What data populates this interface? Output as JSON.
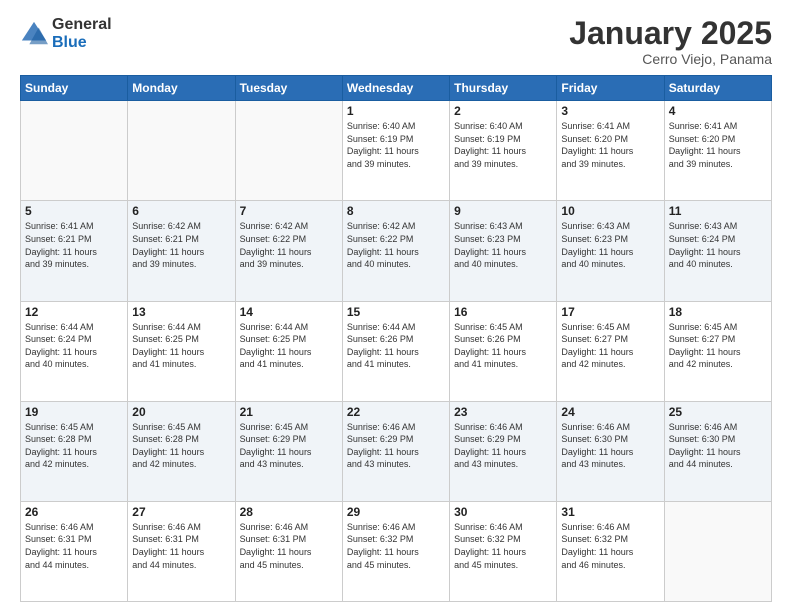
{
  "header": {
    "logo_general": "General",
    "logo_blue": "Blue",
    "month_title": "January 2025",
    "location": "Cerro Viejo, Panama"
  },
  "days_of_week": [
    "Sunday",
    "Monday",
    "Tuesday",
    "Wednesday",
    "Thursday",
    "Friday",
    "Saturday"
  ],
  "weeks": [
    {
      "alt": false,
      "days": [
        {
          "num": "",
          "info": ""
        },
        {
          "num": "",
          "info": ""
        },
        {
          "num": "",
          "info": ""
        },
        {
          "num": "1",
          "info": "Sunrise: 6:40 AM\nSunset: 6:19 PM\nDaylight: 11 hours\nand 39 minutes."
        },
        {
          "num": "2",
          "info": "Sunrise: 6:40 AM\nSunset: 6:19 PM\nDaylight: 11 hours\nand 39 minutes."
        },
        {
          "num": "3",
          "info": "Sunrise: 6:41 AM\nSunset: 6:20 PM\nDaylight: 11 hours\nand 39 minutes."
        },
        {
          "num": "4",
          "info": "Sunrise: 6:41 AM\nSunset: 6:20 PM\nDaylight: 11 hours\nand 39 minutes."
        }
      ]
    },
    {
      "alt": true,
      "days": [
        {
          "num": "5",
          "info": "Sunrise: 6:41 AM\nSunset: 6:21 PM\nDaylight: 11 hours\nand 39 minutes."
        },
        {
          "num": "6",
          "info": "Sunrise: 6:42 AM\nSunset: 6:21 PM\nDaylight: 11 hours\nand 39 minutes."
        },
        {
          "num": "7",
          "info": "Sunrise: 6:42 AM\nSunset: 6:22 PM\nDaylight: 11 hours\nand 39 minutes."
        },
        {
          "num": "8",
          "info": "Sunrise: 6:42 AM\nSunset: 6:22 PM\nDaylight: 11 hours\nand 40 minutes."
        },
        {
          "num": "9",
          "info": "Sunrise: 6:43 AM\nSunset: 6:23 PM\nDaylight: 11 hours\nand 40 minutes."
        },
        {
          "num": "10",
          "info": "Sunrise: 6:43 AM\nSunset: 6:23 PM\nDaylight: 11 hours\nand 40 minutes."
        },
        {
          "num": "11",
          "info": "Sunrise: 6:43 AM\nSunset: 6:24 PM\nDaylight: 11 hours\nand 40 minutes."
        }
      ]
    },
    {
      "alt": false,
      "days": [
        {
          "num": "12",
          "info": "Sunrise: 6:44 AM\nSunset: 6:24 PM\nDaylight: 11 hours\nand 40 minutes."
        },
        {
          "num": "13",
          "info": "Sunrise: 6:44 AM\nSunset: 6:25 PM\nDaylight: 11 hours\nand 41 minutes."
        },
        {
          "num": "14",
          "info": "Sunrise: 6:44 AM\nSunset: 6:25 PM\nDaylight: 11 hours\nand 41 minutes."
        },
        {
          "num": "15",
          "info": "Sunrise: 6:44 AM\nSunset: 6:26 PM\nDaylight: 11 hours\nand 41 minutes."
        },
        {
          "num": "16",
          "info": "Sunrise: 6:45 AM\nSunset: 6:26 PM\nDaylight: 11 hours\nand 41 minutes."
        },
        {
          "num": "17",
          "info": "Sunrise: 6:45 AM\nSunset: 6:27 PM\nDaylight: 11 hours\nand 42 minutes."
        },
        {
          "num": "18",
          "info": "Sunrise: 6:45 AM\nSunset: 6:27 PM\nDaylight: 11 hours\nand 42 minutes."
        }
      ]
    },
    {
      "alt": true,
      "days": [
        {
          "num": "19",
          "info": "Sunrise: 6:45 AM\nSunset: 6:28 PM\nDaylight: 11 hours\nand 42 minutes."
        },
        {
          "num": "20",
          "info": "Sunrise: 6:45 AM\nSunset: 6:28 PM\nDaylight: 11 hours\nand 42 minutes."
        },
        {
          "num": "21",
          "info": "Sunrise: 6:45 AM\nSunset: 6:29 PM\nDaylight: 11 hours\nand 43 minutes."
        },
        {
          "num": "22",
          "info": "Sunrise: 6:46 AM\nSunset: 6:29 PM\nDaylight: 11 hours\nand 43 minutes."
        },
        {
          "num": "23",
          "info": "Sunrise: 6:46 AM\nSunset: 6:29 PM\nDaylight: 11 hours\nand 43 minutes."
        },
        {
          "num": "24",
          "info": "Sunrise: 6:46 AM\nSunset: 6:30 PM\nDaylight: 11 hours\nand 43 minutes."
        },
        {
          "num": "25",
          "info": "Sunrise: 6:46 AM\nSunset: 6:30 PM\nDaylight: 11 hours\nand 44 minutes."
        }
      ]
    },
    {
      "alt": false,
      "days": [
        {
          "num": "26",
          "info": "Sunrise: 6:46 AM\nSunset: 6:31 PM\nDaylight: 11 hours\nand 44 minutes."
        },
        {
          "num": "27",
          "info": "Sunrise: 6:46 AM\nSunset: 6:31 PM\nDaylight: 11 hours\nand 44 minutes."
        },
        {
          "num": "28",
          "info": "Sunrise: 6:46 AM\nSunset: 6:31 PM\nDaylight: 11 hours\nand 45 minutes."
        },
        {
          "num": "29",
          "info": "Sunrise: 6:46 AM\nSunset: 6:32 PM\nDaylight: 11 hours\nand 45 minutes."
        },
        {
          "num": "30",
          "info": "Sunrise: 6:46 AM\nSunset: 6:32 PM\nDaylight: 11 hours\nand 45 minutes."
        },
        {
          "num": "31",
          "info": "Sunrise: 6:46 AM\nSunset: 6:32 PM\nDaylight: 11 hours\nand 46 minutes."
        },
        {
          "num": "",
          "info": ""
        }
      ]
    }
  ]
}
